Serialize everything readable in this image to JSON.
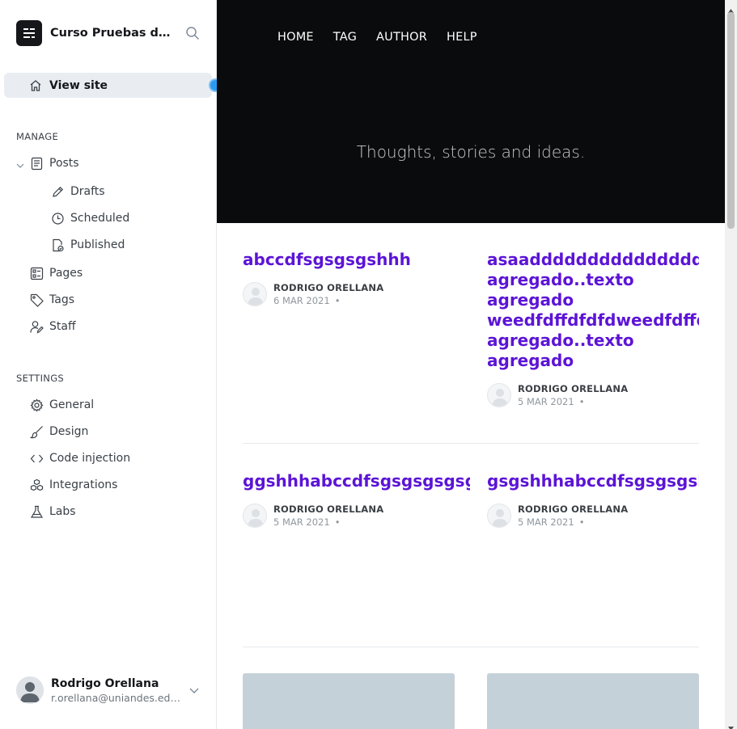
{
  "sidebar": {
    "brand_title": "Curso Pruebas de ...",
    "view_site": "View site",
    "manage_title": "MANAGE",
    "posts": "Posts",
    "drafts": "Drafts",
    "scheduled": "Scheduled",
    "published": "Published",
    "pages": "Pages",
    "tags": "Tags",
    "staff": "Staff",
    "settings_title": "SETTINGS",
    "general": "General",
    "design": "Design",
    "code_injection": "Code injection",
    "integrations": "Integrations",
    "labs": "Labs"
  },
  "user": {
    "name": "Rodrigo Orellana",
    "email": "r.orellana@uniandes.edu..."
  },
  "site": {
    "nav": [
      "HOME",
      "TAG",
      "AUTHOR",
      "HELP"
    ],
    "tagline": "Thoughts, stories and ideas.",
    "posts": [
      {
        "title_lines": [
          "abccdfsgsgsgshhh"
        ],
        "author": "RODRIGO ORELLANA",
        "date": "6 MAR 2021"
      },
      {
        "title_lines": [
          "asaaddddddddddddddddddd",
          "agregado..texto",
          "agregado",
          "weedfdffdfdfdweedfdffdfdf",
          "agregado..texto",
          "agregado"
        ],
        "author": "RODRIGO ORELLANA",
        "date": "5 MAR 2021"
      },
      {
        "title_lines": [
          "ggshhhabccdfsgsgsgsgsgshhh"
        ],
        "author": "RODRIGO ORELLANA",
        "date": "5 MAR 2021"
      },
      {
        "title_lines": [
          "gsgshhhabccdfsgsgsgshhh"
        ],
        "author": "RODRIGO ORELLANA",
        "date": "5 MAR 2021"
      }
    ],
    "date_separator": "•"
  },
  "colors": {
    "accent": "#5c14d6",
    "hero_bg": "#0a0b0c",
    "handle": "#2a9bf0"
  },
  "icons": [
    "ghost-logo-icon",
    "search-icon",
    "home-icon",
    "posts-icon",
    "pencil-icon",
    "clock-icon",
    "published-icon",
    "pages-icon",
    "tag-icon",
    "staff-icon",
    "gear-icon",
    "brush-icon",
    "code-icon",
    "integrations-icon",
    "labs-icon",
    "chevron-down-icon"
  ]
}
